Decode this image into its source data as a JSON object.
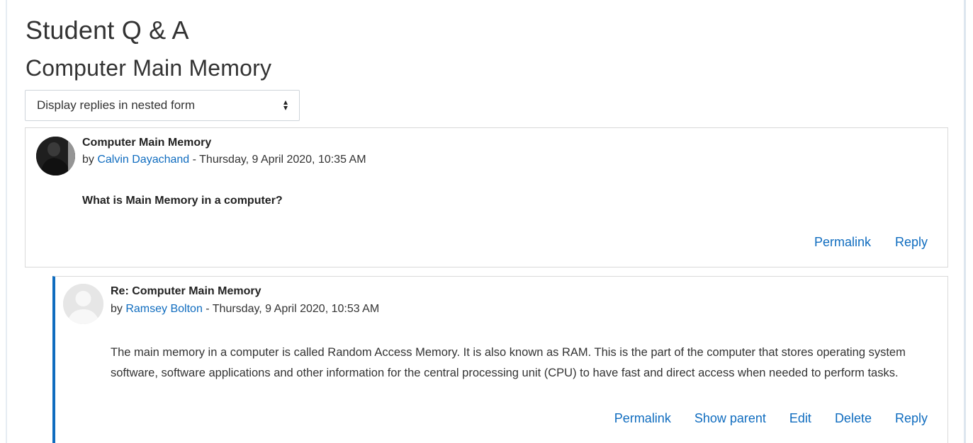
{
  "page": {
    "title": "Student Q & A",
    "subtitle": "Computer Main Memory"
  },
  "display_mode": {
    "selected": "Display replies in nested form"
  },
  "posts": [
    {
      "subject": "Computer Main Memory",
      "by_prefix": "by ",
      "author": "Calvin Dayachand",
      "date_sep": " - ",
      "date": "Thursday, 9 April 2020, 10:35 AM",
      "message": "What is Main Memory in a computer?",
      "actions": [
        "Permalink",
        "Reply"
      ]
    },
    {
      "subject": "Re: Computer Main Memory",
      "by_prefix": "by ",
      "author": "Ramsey Bolton",
      "date_sep": " - ",
      "date": "Thursday, 9 April 2020, 10:53 AM",
      "message": "The main memory in a computer is called Random Access Memory. It is also known as RAM. This is the part of the computer that stores operating system software, software applications and other information for the central processing unit (CPU) to have fast and direct access when needed to perform tasks.",
      "actions": [
        "Permalink",
        "Show parent",
        "Edit",
        "Delete",
        "Reply"
      ]
    }
  ],
  "colors": {
    "link": "#0f6cbf",
    "reply_accent": "#0f6cbf"
  }
}
